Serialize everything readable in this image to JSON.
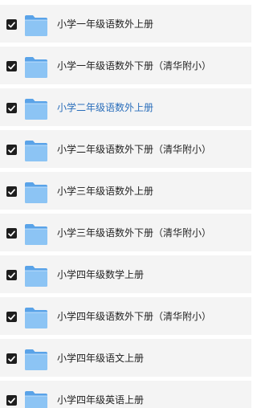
{
  "folders": [
    {
      "name": "小学一年级语数外上册",
      "checked": true,
      "active": false
    },
    {
      "name": "小学一年级语数外下册（清华附小）",
      "checked": true,
      "active": false
    },
    {
      "name": "小学二年级语数外上册",
      "checked": true,
      "active": true
    },
    {
      "name": "小学二年级语数外下册（清华附小）",
      "checked": true,
      "active": false
    },
    {
      "name": "小学三年级语数外上册",
      "checked": true,
      "active": false
    },
    {
      "name": "小学三年级语数外下册（清华附小）",
      "checked": true,
      "active": false
    },
    {
      "name": "小学四年级数学上册",
      "checked": true,
      "active": false
    },
    {
      "name": "小学四年级语数外下册（清华附小）",
      "checked": true,
      "active": false
    },
    {
      "name": "小学四年级语文上册",
      "checked": true,
      "active": false
    },
    {
      "name": "小学四年级英语上册",
      "checked": true,
      "active": false
    }
  ],
  "colors": {
    "row_bg": "#f4f4f4",
    "checkbox": "#1e1e1e",
    "folder_front": "#8cc4f4",
    "folder_back": "#5aa3e8",
    "active_text": "#2a6ebb"
  },
  "icons": {
    "checkbox": "checkbox-checked-icon",
    "folder": "folder-icon"
  }
}
